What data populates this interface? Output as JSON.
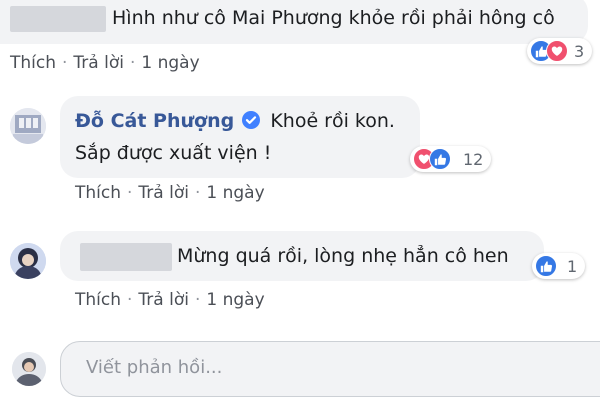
{
  "comments": [
    {
      "text": "Hình như cô Mai Phương khỏe rồi phải hông cô",
      "actions": {
        "like": "Thích",
        "reply": "Trả lời",
        "time": "1 ngày"
      },
      "reactions": {
        "count": "3"
      }
    },
    {
      "author": "Đỗ Cát Phượng",
      "text_line1": "Khoẻ rồi kon.",
      "text_line2": "Sắp được xuất viện !",
      "actions": {
        "like": "Thích",
        "reply": "Trả lời",
        "time": "1 ngày"
      },
      "reactions": {
        "count": "12"
      }
    },
    {
      "text": "Mừng quá rồi, lòng nhẹ hẳn cô hen",
      "actions": {
        "like": "Thích",
        "reply": "Trả lời",
        "time": "1 ngày"
      },
      "reactions": {
        "count": "1"
      }
    }
  ],
  "reply_box": {
    "placeholder": "Viết phản hồi..."
  },
  "colors": {
    "link": "#385898",
    "like": "#3578e5",
    "love": "#f0506e",
    "bubble": "#f2f3f5"
  },
  "separator": "·"
}
